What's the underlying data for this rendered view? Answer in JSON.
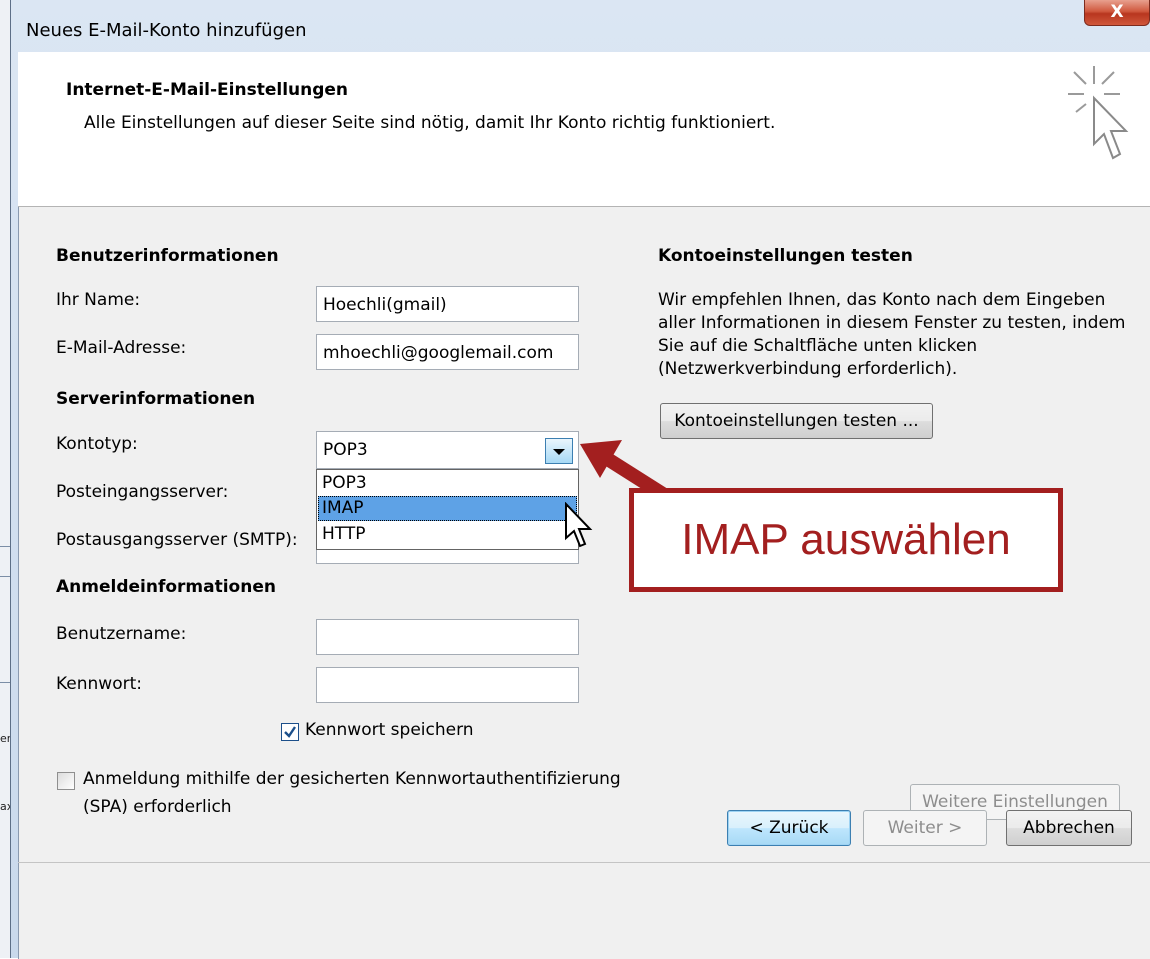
{
  "background_window": {
    "frag_1": "en",
    "frag_2": "ax"
  },
  "window": {
    "title": "Neues E-Mail-Konto hinzufügen",
    "close_glyph": "X"
  },
  "header": {
    "title": "Internet-E-Mail-Einstellungen",
    "subtitle": "Alle Einstellungen auf dieser Seite sind nötig, damit Ihr Konto richtig funktioniert.",
    "icon": "wizard-cursor-icon"
  },
  "user_info": {
    "title": "Benutzerinformationen",
    "name_label": "Ihr Name:",
    "name_value": "Hoechli(gmail)",
    "email_label": "E-Mail-Adresse:",
    "email_value": "mhoechli@googlemail.com"
  },
  "server_info": {
    "title": "Serverinformationen",
    "account_type_label": "Kontotyp:",
    "account_type_value": "POP3",
    "account_type_options": [
      "POP3",
      "IMAP",
      "HTTP"
    ],
    "highlighted_option": "IMAP",
    "incoming_label": "Posteingangsserver:",
    "outgoing_label": "Postausgangsserver (SMTP):"
  },
  "login_info": {
    "title": "Anmeldeinformationen",
    "username_label": "Benutzername:",
    "password_label": "Kennwort:",
    "save_password_label": "Kennwort speichern",
    "save_password_checked": true,
    "spa_label_line1": "Anmeldung mithilfe der gesicherten Kennwortauthentifizierung",
    "spa_label_line2": "(SPA) erforderlich",
    "spa_checked": false
  },
  "test_settings": {
    "title": "Kontoeinstellungen testen",
    "line1": "Wir empfehlen Ihnen, das Konto nach dem Eingeben",
    "line2": "aller Informationen in diesem Fenster zu testen, indem",
    "line3": "Sie auf die Schaltfläche unten klicken",
    "line4": "(Netzwerkverbindung erforderlich).",
    "button_label": "Kontoeinstellungen testen ..."
  },
  "more_settings_label": "Weitere Einstellungen",
  "annotation": {
    "text": "IMAP auswählen",
    "color": "#a31f1f"
  },
  "footer": {
    "back_label": "< Zurück",
    "next_label": "Weiter >",
    "cancel_label": "Abbrechen"
  }
}
